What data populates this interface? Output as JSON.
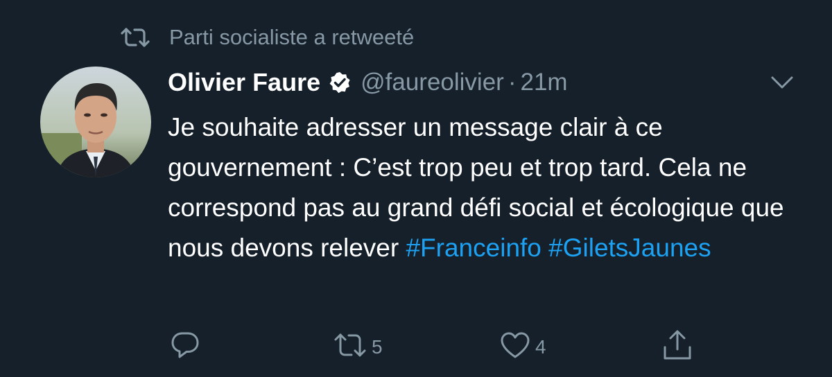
{
  "retweet_context": {
    "icon": "retweet-icon",
    "label": "Parti socialiste a retweeté"
  },
  "author": {
    "display_name": "Olivier Faure",
    "verified": true,
    "handle": "@faureolivier",
    "separator": "·",
    "time": "21m"
  },
  "tweet": {
    "text_main": "Je souhaite adresser un message clair à ce gouvernement : C’est trop peu et trop tard. Cela ne correspond pas au grand défi social et écologique que nous devons relever",
    "hashtags": [
      "#Franceinfo",
      "#GiletsJaunes"
    ]
  },
  "actions": {
    "reply": {
      "icon": "reply-icon"
    },
    "retweet": {
      "icon": "retweet-icon",
      "count": "5"
    },
    "like": {
      "icon": "heart-icon",
      "count": "4"
    },
    "share": {
      "icon": "share-icon"
    }
  },
  "colors": {
    "background": "#15202b",
    "secondary_text": "#8899a6",
    "hashtag": "#1da1f2"
  }
}
